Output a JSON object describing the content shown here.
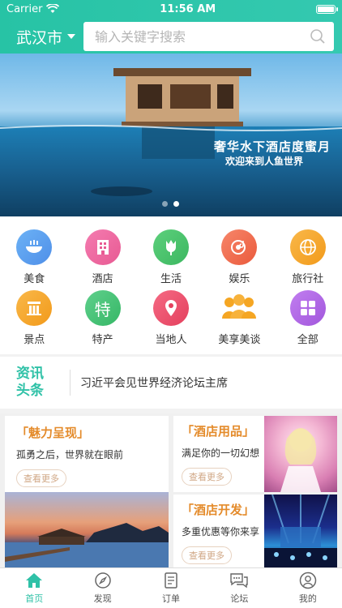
{
  "status": {
    "carrier": "Carrier",
    "time": "11:56 AM"
  },
  "header": {
    "city": "武汉市",
    "search_placeholder": "输入关键字搜索"
  },
  "banner": {
    "title": "奢华水下酒店度蜜月",
    "subtitle": "欢迎来到人鱼世界",
    "page_count": 2,
    "active_index": 1
  },
  "categories": [
    {
      "label": "美食",
      "icon": "food-bowl-icon",
      "color": "#5aa0f0"
    },
    {
      "label": "酒店",
      "icon": "hotel-building-icon",
      "color": "#ef6ba0"
    },
    {
      "label": "生活",
      "icon": "tulip-icon",
      "color": "#4fc36d"
    },
    {
      "label": "娱乐",
      "icon": "music-disc-icon",
      "color": "#f26f4f"
    },
    {
      "label": "旅行社",
      "icon": "globe-icon",
      "color": "#f5a623"
    },
    {
      "label": "景点",
      "icon": "landmark-icon",
      "color": "#f5a623"
    },
    {
      "label": "特产",
      "icon": "specialty-icon",
      "glyph": "特",
      "color": "#46c27a"
    },
    {
      "label": "当地人",
      "icon": "location-pin-icon",
      "color": "#ef4f6a"
    },
    {
      "label": "美享美谈",
      "icon": "people-group-icon",
      "color": "#f5a623"
    },
    {
      "label": "全部",
      "icon": "grid-all-icon",
      "color": "#b36ae2"
    }
  ],
  "news": {
    "tag_line1": "资讯",
    "tag_line2": "头条",
    "headline": "习近平会见世界经济论坛主席"
  },
  "promos": {
    "a": {
      "title": "「魅力呈现」",
      "subtitle": "孤勇之后，世界就在眼前",
      "more": "查看更多"
    },
    "b": {
      "title": "「酒店用品」",
      "subtitle": "满足你的一切幻想",
      "more": "查看更多"
    },
    "c": {
      "title": "「酒店开发」",
      "subtitle": "多重优惠等你来享",
      "more": "查看更多"
    }
  },
  "tabs": [
    {
      "label": "首页",
      "icon": "home-icon",
      "active": true
    },
    {
      "label": "发现",
      "icon": "compass-icon",
      "active": false
    },
    {
      "label": "订单",
      "icon": "order-list-icon",
      "active": false
    },
    {
      "label": "论坛",
      "icon": "forum-chat-icon",
      "active": false
    },
    {
      "label": "我的",
      "icon": "profile-icon",
      "active": false
    }
  ],
  "colors": {
    "accent": "#2fc1a7",
    "promo_title": "#e48b2b"
  }
}
